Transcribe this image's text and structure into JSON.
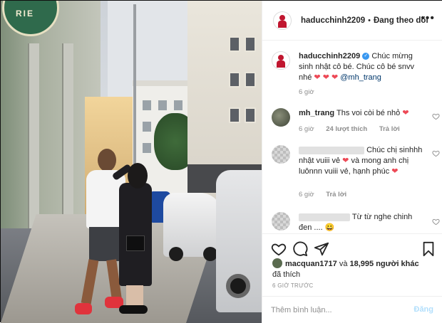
{
  "post": {
    "username": "haducchinh2209",
    "following_label": "Đang theo dõi",
    "caption": {
      "username": "haducchinh2209",
      "text": "Chúc mừng sinh nhật cô bé. Chúc cô bé snvv nhé",
      "mention": "@mh_trang",
      "time": "6 giờ"
    },
    "comments": [
      {
        "username": "mh_trang",
        "text": "Ths voi còi bé nhỏ",
        "time": "6 giờ",
        "likes": "24 lượt thích",
        "reply": "Trả lời"
      },
      {
        "username": "",
        "text_a": "Chúc chị sinhhh nhật vuiii vẻ",
        "text_b": "và mong anh chị luônnn vuiii vẻ, hạnh phúc",
        "time": "6 giờ",
        "reply": "Trả lời"
      },
      {
        "username": "",
        "text": "Từ từ nghe chinh đen ....",
        "emoji": "😀"
      }
    ],
    "likes": {
      "username": "macquan1717",
      "connector": "và",
      "count_text": "18,995 người khác",
      "suffix": "đã thích"
    },
    "timestamp": "6 GIỜ TRƯỚC",
    "add_comment": {
      "placeholder": "Thêm bình luận...",
      "post_label": "Đăng"
    }
  },
  "photo": {
    "sign_text": "RIE"
  },
  "icons": [
    "heart-icon",
    "comment-icon",
    "share-icon",
    "bookmark-icon",
    "more-icon",
    "verified-icon"
  ],
  "colors": {
    "like_heart": "#ed4956",
    "verified": "#3897f0",
    "link": "#00376b",
    "post_button_disabled": "#b2dffc",
    "muted_text": "#8e8e8e"
  }
}
